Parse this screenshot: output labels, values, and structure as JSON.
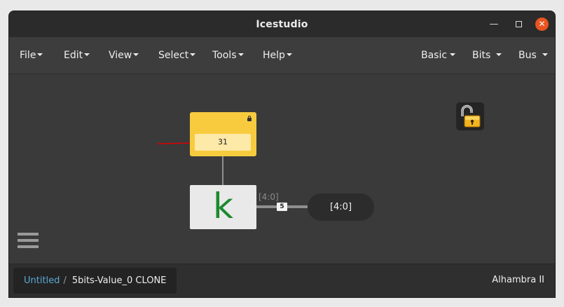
{
  "window": {
    "title": "Icestudio"
  },
  "menubar": {
    "left": [
      "File",
      "Edit",
      "View",
      "Select",
      "Tools",
      "Help"
    ],
    "right": [
      "Basic",
      "Bits",
      "Bus"
    ]
  },
  "canvas": {
    "constant_value": "31",
    "k_glyph": "k",
    "output_wire_label": "[4:0]",
    "bus_width": "5",
    "output_port_label": "[4:0]"
  },
  "statusbar": {
    "breadcrumb_root": "Untitled",
    "breadcrumb_separator": "/",
    "breadcrumb_current": "5bits-Value_0 CLONE",
    "board": "Alhambra II"
  },
  "colors": {
    "constant_block": "#f8cb3f",
    "constant_field": "#fde9a8",
    "wire_gray": "#8f8f8f",
    "bus_wire": "#8f8f8f",
    "annotation_arrow": "#dd0000",
    "k_letter": "#1b8a2e",
    "link_blue": "#5aa9d6",
    "close_button": "#e95420"
  },
  "icons": [
    "close-icon",
    "maximize-icon",
    "minimize-icon",
    "lock-icon",
    "unlock-icon",
    "hamburger-menu-icon",
    "caret-down-icon"
  ]
}
